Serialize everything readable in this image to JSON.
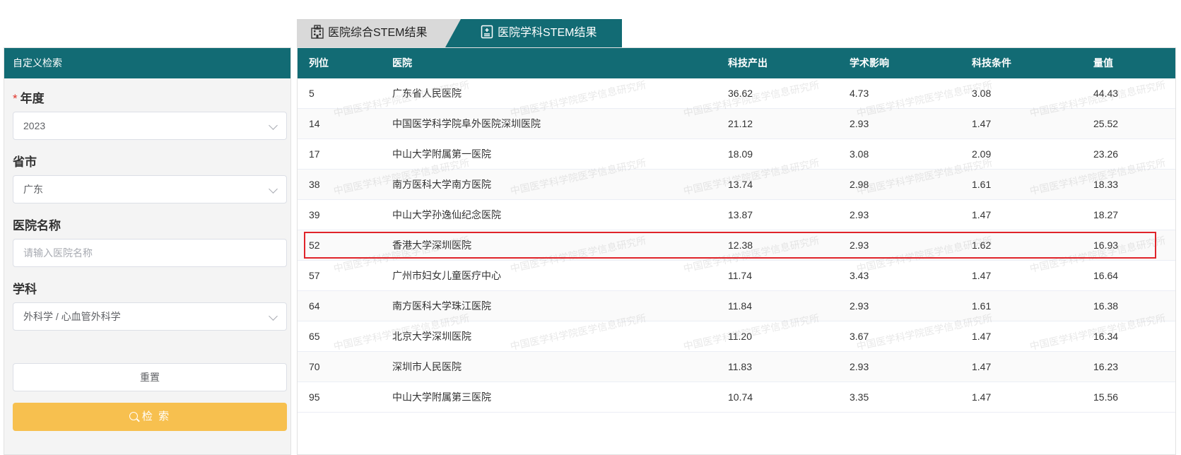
{
  "tabs": [
    {
      "label": "医院综合STEM结果",
      "icon": "hospital-building-icon",
      "active": false
    },
    {
      "label": "医院学科STEM结果",
      "icon": "medical-record-icon",
      "active": true
    }
  ],
  "sidebar": {
    "title": "自定义检索",
    "year": {
      "label": "年度",
      "value": "2023"
    },
    "province": {
      "label": "省市",
      "value": "广东"
    },
    "hospital": {
      "label": "医院名称",
      "placeholder": "请输入医院名称"
    },
    "subject": {
      "label": "学科",
      "value": "外科学 / 心血管外科学"
    },
    "reset_label": "重置",
    "search_label": "检 索"
  },
  "table": {
    "columns": [
      "列位",
      "医院",
      "科技产出",
      "学术影响",
      "科技条件",
      "量值"
    ],
    "rows": [
      [
        "5",
        "广东省人民医院",
        "36.62",
        "4.73",
        "3.08",
        "44.43"
      ],
      [
        "14",
        "中国医学科学院阜外医院深圳医院",
        "21.12",
        "2.93",
        "1.47",
        "25.52"
      ],
      [
        "17",
        "中山大学附属第一医院",
        "18.09",
        "3.08",
        "2.09",
        "23.26"
      ],
      [
        "38",
        "南方医科大学南方医院",
        "13.74",
        "2.98",
        "1.61",
        "18.33"
      ],
      [
        "39",
        "中山大学孙逸仙纪念医院",
        "13.87",
        "2.93",
        "1.47",
        "18.27"
      ],
      [
        "52",
        "香港大学深圳医院",
        "12.38",
        "2.93",
        "1.62",
        "16.93"
      ],
      [
        "57",
        "广州市妇女儿童医疗中心",
        "11.74",
        "3.43",
        "1.47",
        "16.64"
      ],
      [
        "64",
        "南方医科大学珠江医院",
        "11.84",
        "2.93",
        "1.61",
        "16.38"
      ],
      [
        "65",
        "北京大学深圳医院",
        "11.20",
        "3.67",
        "1.47",
        "16.34"
      ],
      [
        "70",
        "深圳市人民医院",
        "11.83",
        "2.93",
        "1.47",
        "16.23"
      ],
      [
        "95",
        "中山大学附属第三医院",
        "10.74",
        "3.35",
        "1.47",
        "15.56"
      ]
    ],
    "highlighted_row": 5
  },
  "watermark": "中国医学科学院医学信息研究所",
  "colors": {
    "primary": "#126b74",
    "accent": "#f7c04f",
    "highlight": "#e0242a"
  }
}
